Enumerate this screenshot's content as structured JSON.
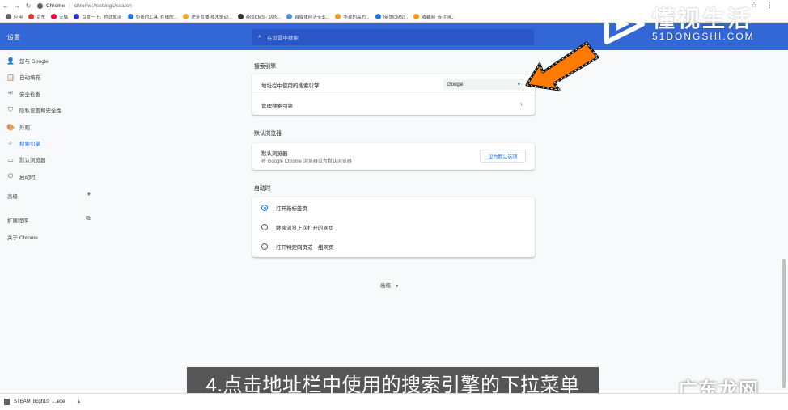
{
  "browser": {
    "tab_label": "Chrome",
    "address": "chrome://settings/search",
    "bookmarks": [
      {
        "label": "应用",
        "color": "#5f6368"
      },
      {
        "label": "京东",
        "color": "#e33333"
      },
      {
        "label": "天猫",
        "color": "#ff0036"
      },
      {
        "label": "百度一下，你就知道",
        "color": "#2932e1"
      },
      {
        "label": "免费的工具_在线的...",
        "color": "#1a73e8"
      },
      {
        "label": "虎牙直播-技术驱动...",
        "color": "#f5a623"
      },
      {
        "label": "帝国CMS - 站长...",
        "color": "#333333"
      },
      {
        "label": "自媒体经济专业...",
        "color": "#4a90d9"
      },
      {
        "label": "华现的高的...",
        "color": "#f39c12"
      },
      {
        "label": "[帝国CMS]...",
        "color": "#1a73e8"
      },
      {
        "label": "收藏网_专注网...",
        "color": "#ff9800"
      }
    ]
  },
  "header": {
    "title": "设置",
    "search_placeholder": "在设置中搜索"
  },
  "sidebar": {
    "items": [
      {
        "label": "您与 Google",
        "icon": "person-icon",
        "glyph": "👤"
      },
      {
        "label": "自动填充",
        "icon": "clipboard-icon",
        "glyph": "📋"
      },
      {
        "label": "安全检查",
        "icon": "shield-check-icon",
        "glyph": "⛨"
      },
      {
        "label": "隐私设置和安全性",
        "icon": "shield-icon",
        "glyph": "⛉"
      },
      {
        "label": "外观",
        "icon": "palette-icon",
        "glyph": "🎨"
      },
      {
        "label": "搜索引擎",
        "icon": "search-icon",
        "glyph": "⌕",
        "active": true
      },
      {
        "label": "默认浏览器",
        "icon": "browser-icon",
        "glyph": "▭"
      },
      {
        "label": "启动时",
        "icon": "power-icon",
        "glyph": "⏻"
      }
    ],
    "advanced": "高级",
    "extensions": "扩展程序",
    "about": "关于 Chrome"
  },
  "search_engine": {
    "section_title": "搜索引擎",
    "address_bar_label": "地址栏中使用的搜索引擎",
    "engine_value": "Google",
    "manage_label": "管理搜索引擎"
  },
  "default_browser": {
    "section_title": "默认浏览器",
    "label": "默认浏览器",
    "sublabel": "将 Google Chrome 浏览器设为默认浏览器",
    "button": "设为默认选项"
  },
  "startup": {
    "section_title": "启动时",
    "options": [
      {
        "label": "打开新标签页",
        "selected": true
      },
      {
        "label": "继续浏览上次打开的网页",
        "selected": false
      },
      {
        "label": "打开特定网页或一组网页",
        "selected": false
      }
    ]
  },
  "advanced_bottom": "高级",
  "caption": "4.点击地址栏中使用的搜索引擎的下拉菜单",
  "watermark": {
    "name": "懂视生活",
    "domain": "51DONGSHI.COM",
    "bottom": "广东龙网"
  },
  "download": {
    "file": "STEAM_bcgh10_....exe"
  },
  "colors": {
    "header": "#3367d6",
    "accent": "#1a73e8",
    "arrow": "#ff7a00"
  }
}
